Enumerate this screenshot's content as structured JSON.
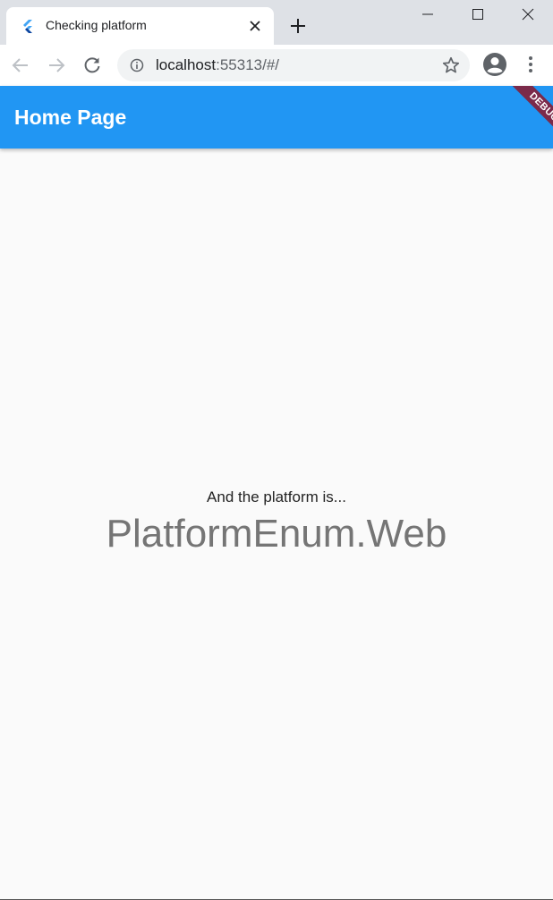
{
  "browser": {
    "tab": {
      "title": "Checking platform",
      "favicon": "flutter-logo-icon"
    },
    "window_controls": [
      "minimize-icon",
      "maximize-icon",
      "close-icon"
    ],
    "toolbar": {
      "url_host": "localhost",
      "url_rest": ":55313/#/",
      "icons": [
        "back-arrow-icon",
        "forward-arrow-icon",
        "reload-icon",
        "info-icon",
        "star-icon",
        "profile-icon",
        "more-vert-icon"
      ]
    }
  },
  "app": {
    "appbar_title": "Home Page",
    "appbar_color": "#2196f3",
    "debug_banner": "DEBUG",
    "caption": "And the platform is...",
    "platform_value": "PlatformEnum.Web"
  }
}
